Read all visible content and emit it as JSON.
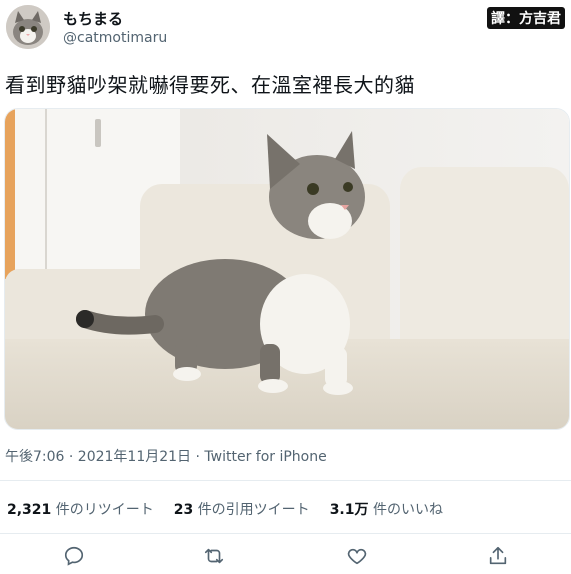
{
  "user": {
    "display_name": "もちまる",
    "handle": "@catmotimaru"
  },
  "translator_credit": "譯：方吉君",
  "tweet": {
    "text": "看到野貓吵架就嚇得要死、在溫室裡長大的貓",
    "timestamp": "午後7:06 · 2021年11月21日",
    "source": "Twitter for iPhone"
  },
  "stats": {
    "retweets_count": "2,321",
    "retweets_label": "件のリツイート",
    "quotes_count": "23",
    "quotes_label": "件の引用ツイート",
    "likes_count": "3.1万",
    "likes_label": "件のいいね"
  },
  "actions": {
    "icons": [
      "reply-icon",
      "retweet-icon",
      "like-icon",
      "share-icon"
    ]
  },
  "colors": {
    "text": "#0f1419",
    "secondary": "#536471",
    "divider": "#e6ecf0"
  }
}
